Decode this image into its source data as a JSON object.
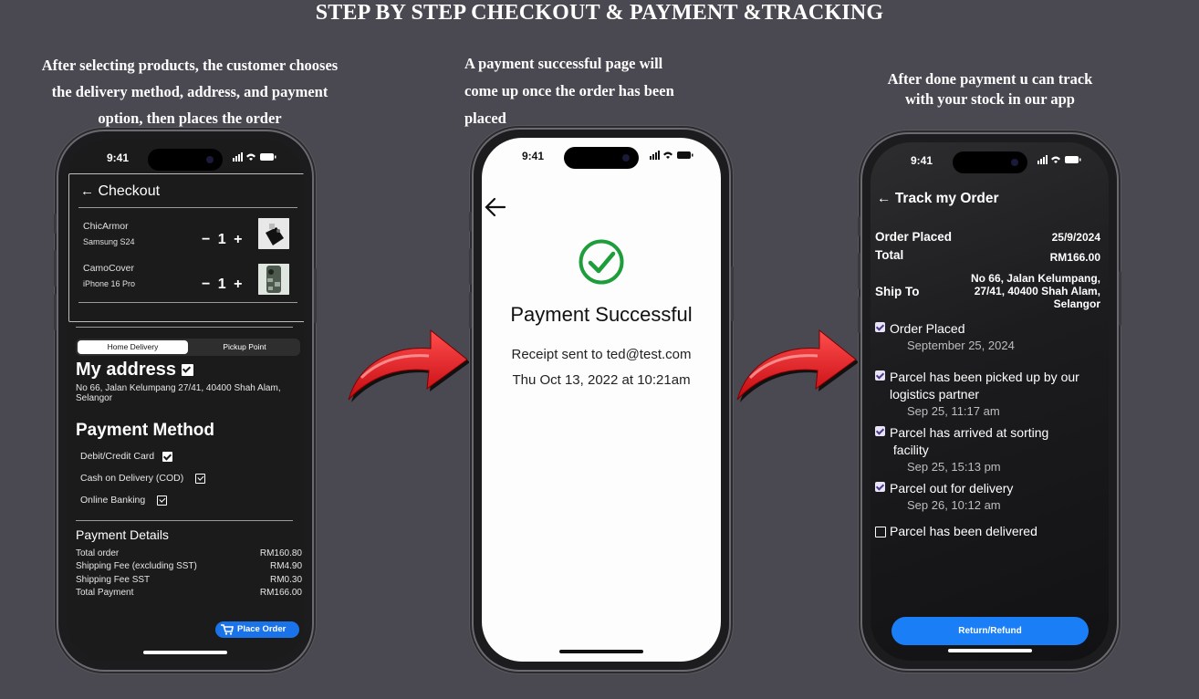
{
  "page_title": "STEP BY STEP CHECKOUT & PAYMENT &TRACKING",
  "captions": {
    "step1_lines": [
      "After selecting products, the customer chooses",
      "the delivery method, address, and payment",
      "option, then places the order"
    ],
    "step2_lines": [
      "A payment successful page will",
      "come up once the order has been",
      "placed"
    ],
    "step3_lines": [
      "After done payment u can track",
      "with your stock in our app"
    ]
  },
  "status_bar": {
    "time": "9:41"
  },
  "checkout": {
    "header": "Checkout",
    "products": [
      {
        "name": "ChicArmor",
        "model": "Samsung S24",
        "qty": "1"
      },
      {
        "name": "CamoCover",
        "model": "iPhone 16 Pro",
        "qty": "1"
      }
    ],
    "qty_minus": "−",
    "qty_plus": "+",
    "delivery_tabs": [
      "Home Delivery",
      "Pickup Point"
    ],
    "address_title": "My address",
    "address_text": "No 66, Jalan Kelumpang 27/41, 40400 Shah Alam, Selangor",
    "payment_method_title": "Payment Method",
    "payment_methods": [
      "Debit/Credit Card",
      "Cash on Delivery (COD)",
      "Online Banking"
    ],
    "payment_details_title": "Payment Details",
    "payment_details": [
      {
        "label": "Total order",
        "value": "RM160.80"
      },
      {
        "label": "Shipping Fee (excluding SST)",
        "value": "RM4.90"
      },
      {
        "label": "Shipping Fee SST",
        "value": "RM0.30"
      },
      {
        "label": "Total Payment",
        "value": "RM166.00"
      }
    ],
    "place_order_label": "Place Order"
  },
  "payment_success": {
    "title": "Payment Successful",
    "receipt": "Receipt sent to ted@test.com",
    "datetime": "Thu Oct 13, 2022 at 10:21am",
    "accent_color": "#1e9e3a"
  },
  "tracking": {
    "header": "Track my Order",
    "order_placed_label": "Order Placed",
    "order_placed_date": "25/9/2024",
    "total_label": "Total",
    "total_value": "RM166.00",
    "ship_to_label": "Ship To",
    "ship_to_lines": [
      "No 66, Jalan Kelumpang,",
      "27/41, 40400 Shah Alam,",
      "Selangor"
    ],
    "steps": [
      {
        "title_lines": [
          "Order Placed"
        ],
        "time": "September 25, 2024",
        "done": true
      },
      {
        "title_lines": [
          "Parcel has been picked up by our",
          "logistics partner"
        ],
        "time": "Sep 25, 11:17 am",
        "done": true
      },
      {
        "title_lines": [
          "Parcel has arrived at sorting",
          " facility"
        ],
        "time": "Sep 25, 15:13 pm",
        "done": true
      },
      {
        "title_lines": [
          "Parcel out for delivery"
        ],
        "time": "Sep 26, 10:12 am",
        "done": true
      },
      {
        "title_lines": [
          "Parcel has been delivered"
        ],
        "time": "",
        "done": false
      }
    ],
    "return_refund_label": "Return/Refund"
  },
  "colors": {
    "background": "#4a4851",
    "primary_button": "#1a73e8",
    "arrow": "#e8141c"
  }
}
